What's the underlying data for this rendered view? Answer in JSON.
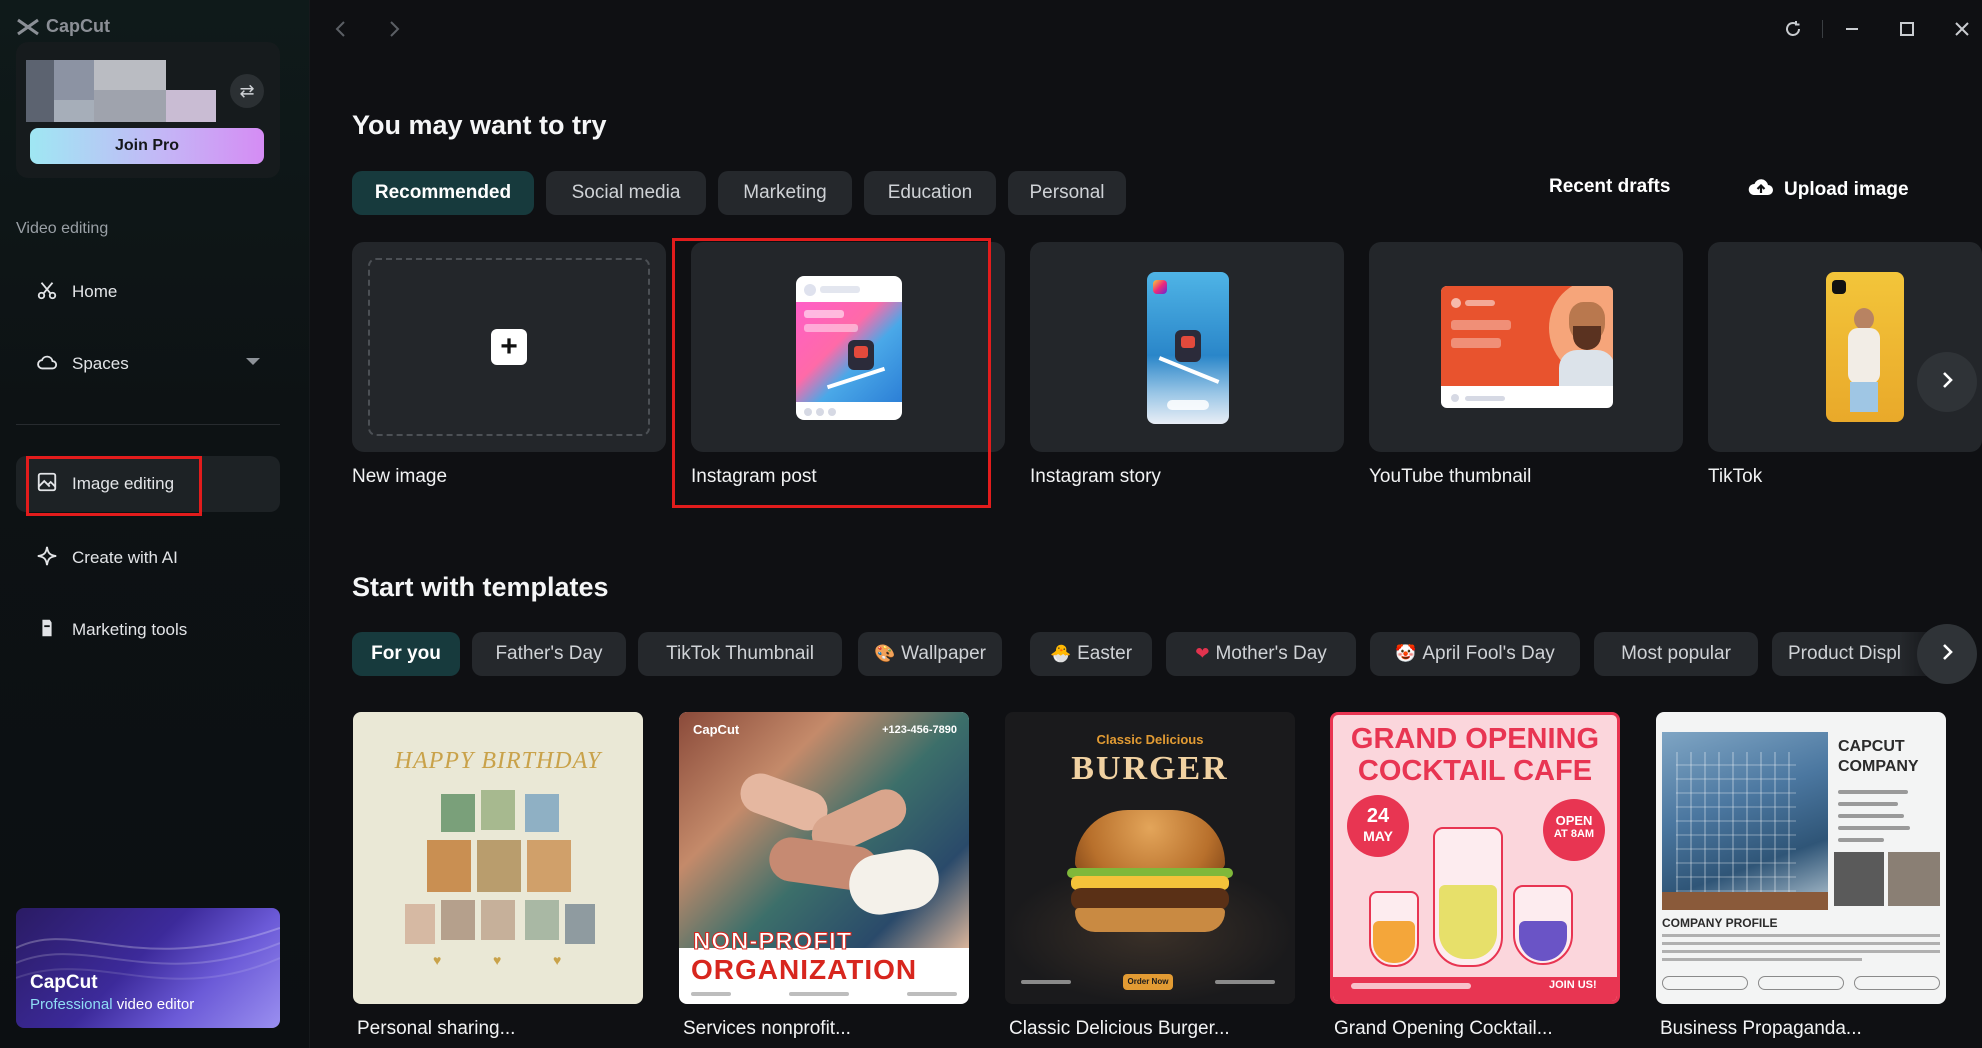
{
  "app": {
    "name": "CapCut"
  },
  "account": {
    "join_pro_label": "Join Pro"
  },
  "sidebar": {
    "section_label": "Video editing",
    "items": [
      {
        "label": "Home",
        "icon": "scissors-icon"
      },
      {
        "label": "Spaces",
        "icon": "cloud-icon"
      },
      {
        "label": "Image editing",
        "icon": "image-icon"
      },
      {
        "label": "Create with AI",
        "icon": "sparkle-icon"
      },
      {
        "label": "Marketing tools",
        "icon": "bag-icon"
      }
    ],
    "promo": {
      "title": "CapCut",
      "sub_a": "Professional",
      "sub_b": " video editor"
    }
  },
  "try_section": {
    "title": "You may want to try",
    "tabs": [
      "Recommended",
      "Social media",
      "Marketing",
      "Education",
      "Personal"
    ],
    "selected_tab": "Recommended",
    "recent_drafts_label": "Recent drafts",
    "upload_label": "Upload image",
    "cards": [
      {
        "label": "New image"
      },
      {
        "label": "Instagram post"
      },
      {
        "label": "Instagram story"
      },
      {
        "label": "YouTube thumbnail"
      },
      {
        "label": "TikTok"
      }
    ]
  },
  "templates_section": {
    "title": "Start with templates",
    "chips": [
      {
        "label": "For you",
        "emoji": ""
      },
      {
        "label": "Father's Day",
        "emoji": ""
      },
      {
        "label": "TikTok Thumbnail",
        "emoji": ""
      },
      {
        "label": "Wallpaper",
        "emoji": "🎨"
      },
      {
        "label": "Easter",
        "emoji": "🐣"
      },
      {
        "label": "Mother's Day",
        "emoji": "❤"
      },
      {
        "label": "April Fool's Day",
        "emoji": "🤡"
      },
      {
        "label": "Most popular",
        "emoji": ""
      },
      {
        "label": "Product Displ",
        "emoji": ""
      }
    ],
    "items": [
      {
        "label": "Personal sharing...",
        "art_text": "HAPPY BIRTHDAY"
      },
      {
        "label": "Services nonprofit...",
        "art_text_1": "NON-PROFIT",
        "art_text_2": "ORGANIZATION",
        "art_brand": "CapCut",
        "art_phone": "+123-456-7890"
      },
      {
        "label": "Classic Delicious Burger...",
        "art_text_1": "Classic Delicious",
        "art_text_2": "BURGER",
        "art_btn": "Order Now"
      },
      {
        "label": "Grand Opening Cocktail...",
        "art_text_1": "GRAND OPENING",
        "art_text_2": "COCKTAIL CAFE",
        "art_date_1": "24",
        "art_date_2": "MAY",
        "art_open_1": "OPEN",
        "art_open_2": "AT 8AM",
        "art_join": "JOIN US!"
      },
      {
        "label": "Business Propaganda...",
        "art_text_1": "CAPCUT",
        "art_text_2": "COMPANY",
        "art_text_3": "COMPANY PROFILE"
      }
    ]
  }
}
